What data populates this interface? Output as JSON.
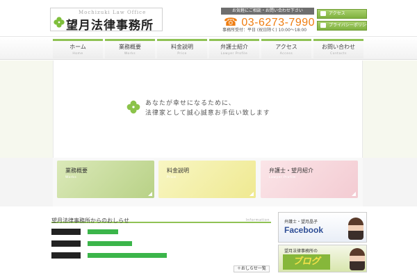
{
  "header": {
    "logo_sub": "Mochizuki Law Office",
    "logo_title": "望月法律事務所",
    "phone_caption": "お気軽にご相談・お問い合わせ下さい",
    "phone_number": "03-6273-7990",
    "phone_hours": "事務所受付：平日 (祝日除く) 10:00～18:00",
    "side_links": [
      "アクセス",
      "プライバシーポリシー"
    ]
  },
  "nav": {
    "items": [
      {
        "label": "ホーム",
        "sub": "Home"
      },
      {
        "label": "業務概要",
        "sub": "Works"
      },
      {
        "label": "料金説明",
        "sub": "Price"
      },
      {
        "label": "弁護士紹介",
        "sub": "Lawyer Profile"
      },
      {
        "label": "アクセス",
        "sub": "Access"
      },
      {
        "label": "お問い合わせ",
        "sub": "Contacts"
      }
    ]
  },
  "hero": {
    "line1": "あなたが幸せになるために、",
    "line2": "法律家として誠心誠意お手伝い致します"
  },
  "features": [
    {
      "title": "業務概要",
      "sub": "Works"
    },
    {
      "title": "料金説明",
      "sub": "Price"
    },
    {
      "title": "弁護士・望月紹介",
      "sub": "Lawyer Profile"
    }
  ],
  "news": {
    "title": "望月法律事務所からのおしらせ",
    "title_en": "Information",
    "more": "＋おしらせ一覧"
  },
  "banners": {
    "fb_small": "弁護士・望月晶子",
    "fb_big": "Facebook",
    "blog_small": "望月法律事務所の",
    "blog_big": "ブログ"
  },
  "colors": {
    "accent": "#8fc254",
    "phone": "#ef7d10",
    "link": "#3bb54a"
  }
}
